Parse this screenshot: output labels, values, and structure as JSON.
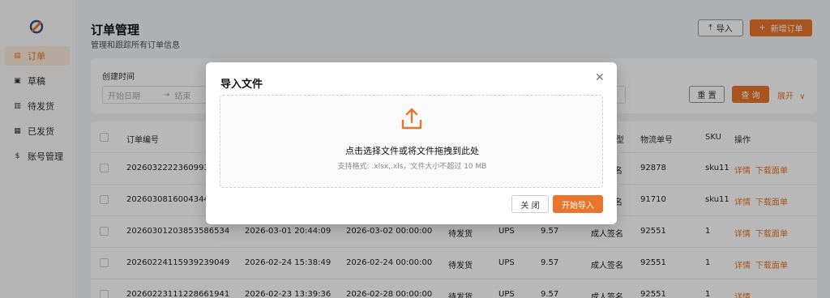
{
  "sidebar": {
    "items": [
      {
        "label": "订单",
        "icon": "clipboard-icon",
        "active": true
      },
      {
        "label": "草稿",
        "icon": "draft-icon",
        "active": false
      },
      {
        "label": "待发货",
        "icon": "pending-box-icon",
        "active": false
      },
      {
        "label": "已发货",
        "icon": "shipped-box-icon",
        "active": false
      },
      {
        "label": "账号管理",
        "icon": "account-icon",
        "active": false
      }
    ]
  },
  "header": {
    "title": "订单管理",
    "subtitle": "管理和跟踪所有订单信息",
    "import_label": "导入",
    "new_order_label": "新增订单"
  },
  "filters": {
    "created_time_label": "创建时间",
    "start_placeholder": "开始日期",
    "end_placeholder": "结束",
    "reset_label": "重 置",
    "query_label": "查 询",
    "expand_label": "展开"
  },
  "table": {
    "headers": [
      "订单编号",
      "型",
      "物流单号",
      "SKU",
      "操作"
    ],
    "rows": [
      {
        "order_no": "2026032222360993",
        "created": "",
        "ship_by": "",
        "status": "",
        "carrier": "",
        "price": "",
        "sig": "名",
        "tracking": "92878",
        "sku": "sku11",
        "actions": [
          "详情",
          "下载面单"
        ]
      },
      {
        "order_no": "2026030816004344",
        "created": "",
        "ship_by": "",
        "status": "",
        "carrier": "",
        "price": "",
        "sig": "名",
        "tracking": "91710",
        "sku": "sku11",
        "actions": [
          "详情",
          "下载面单"
        ]
      },
      {
        "order_no": "20260301203853586534",
        "created": "2026-03-01 20:44:09",
        "ship_by": "2026-03-02 00:00:00",
        "status": "待发货",
        "carrier": "UPS",
        "price": "9.57",
        "sig": "成人签名",
        "tracking": "92551",
        "sku": "1",
        "actions": [
          "详情",
          "下载面单"
        ]
      },
      {
        "order_no": "20260224115939239049",
        "created": "2026-02-24 15:38:49",
        "ship_by": "2026-02-24 00:00:00",
        "status": "待发货",
        "carrier": "UPS",
        "price": "9.57",
        "sig": "成人签名",
        "tracking": "92551",
        "sku": "1",
        "actions": [
          "详情",
          "下载面单"
        ]
      },
      {
        "order_no": "20260223111228661941",
        "created": "2026-02-23 13:39:36",
        "ship_by": "2026-02-28 00:00:00",
        "status": "待发货",
        "carrier": "UPS",
        "price": "9.57",
        "sig": "成人签名",
        "tracking": "92551",
        "sku": "1",
        "actions": [
          "详情"
        ]
      }
    ]
  },
  "modal": {
    "title": "导入文件",
    "drop_main": "点击选择文件或将文件拖拽到此处",
    "drop_sub": "支持格式: .xlsx,.xls，文件大小不超过 10 MB",
    "close_label": "关 闭",
    "start_label": "开始导入"
  },
  "colors": {
    "accent": "#e8752b"
  }
}
